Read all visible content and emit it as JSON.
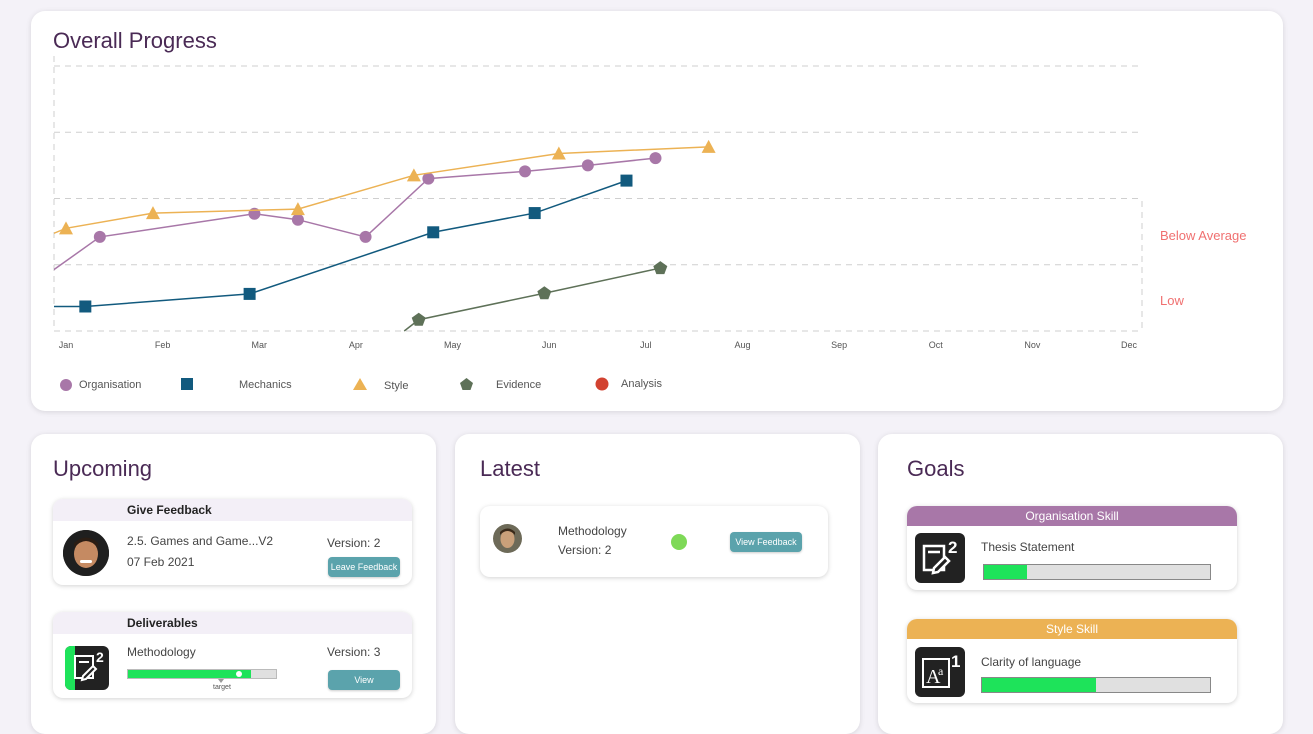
{
  "progress": {
    "title": "Overall Progress",
    "levels": [
      "Below Average",
      "Low"
    ],
    "level_colors": {
      "label": "#f07070"
    }
  },
  "chart_data": {
    "type": "line",
    "title": "Overall Progress",
    "x_ticks": [
      "Jan",
      "Feb",
      "Mar",
      "Apr",
      "May",
      "Jun",
      "Jul",
      "Aug",
      "Sep",
      "Oct",
      "Nov",
      "Dec"
    ],
    "x_domain": [
      0,
      11
    ],
    "y_domain": [
      0,
      4
    ],
    "y_level_labels": {
      "Below Average": 1.5,
      "Low": 0.5
    },
    "grid": "dashed horizontal",
    "legend_position": "bottom-left",
    "series": [
      {
        "name": "Organisation",
        "marker": "circle",
        "color": "#a877a8",
        "points": [
          [
            -0.15,
            0.9
          ],
          [
            0.35,
            1.42
          ],
          [
            1.95,
            1.77
          ],
          [
            2.4,
            1.68
          ],
          [
            3.1,
            1.42
          ],
          [
            3.75,
            2.3
          ],
          [
            4.75,
            2.41
          ],
          [
            5.4,
            2.5
          ],
          [
            6.1,
            2.61
          ]
        ]
      },
      {
        "name": "Mechanics",
        "marker": "square",
        "color": "#125a7e",
        "points": [
          [
            -0.15,
            0.37
          ],
          [
            0.2,
            0.37
          ],
          [
            1.9,
            0.56
          ],
          [
            3.8,
            1.49
          ],
          [
            4.85,
            1.78
          ],
          [
            5.8,
            2.27
          ]
        ]
      },
      {
        "name": "Style",
        "marker": "triangle",
        "color": "#ecb254",
        "points": [
          [
            -0.15,
            1.46
          ],
          [
            0.0,
            1.55
          ],
          [
            0.9,
            1.78
          ],
          [
            2.4,
            1.84
          ],
          [
            3.6,
            2.35
          ],
          [
            5.1,
            2.68
          ],
          [
            6.65,
            2.78
          ]
        ]
      },
      {
        "name": "Evidence",
        "marker": "pentagon",
        "color": "#5e7158",
        "points": [
          [
            3.5,
            0.0
          ],
          [
            3.65,
            0.17
          ],
          [
            4.95,
            0.57
          ],
          [
            6.15,
            0.95
          ]
        ]
      },
      {
        "name": "Analysis",
        "marker": "circle",
        "color": "#d24230",
        "points": []
      }
    ]
  },
  "legend": [
    {
      "label": "Organisation",
      "icon": "circle-icon",
      "color": "#a877a8"
    },
    {
      "label": "Mechanics",
      "icon": "square-icon",
      "color": "#125a7e"
    },
    {
      "label": "Style",
      "icon": "triangle-icon",
      "color": "#ecb254"
    },
    {
      "label": "Evidence",
      "icon": "pentagon-icon",
      "color": "#5e7158"
    },
    {
      "label": "Analysis",
      "icon": "circle-icon",
      "color": "#d24230"
    }
  ],
  "upcoming": {
    "title": "Upcoming",
    "feedback": {
      "heading": "Give Feedback",
      "name": "2.5. Games and Game...V2",
      "date": "07 Feb 2021",
      "version": "Version: 2",
      "button": "Leave Feedback"
    },
    "deliverables": {
      "heading": "Deliverables",
      "name": "Methodology",
      "version": "Version: 3",
      "progress": 0.83,
      "target_label": "target",
      "button": "View"
    }
  },
  "latest": {
    "title": "Latest",
    "item": {
      "name": "Methodology",
      "version": "Version: 2",
      "status_color": "#7ed957",
      "button": "View Feedback"
    }
  },
  "goals": {
    "title": "Goals",
    "items": [
      {
        "heading": "Organisation Skill",
        "label": "Thesis Statement",
        "progress": 0.19,
        "head_color": "#a877a8"
      },
      {
        "heading": "Style Skill",
        "label": "Clarity of language",
        "progress": 0.5,
        "head_color": "#ecb254"
      }
    ]
  }
}
